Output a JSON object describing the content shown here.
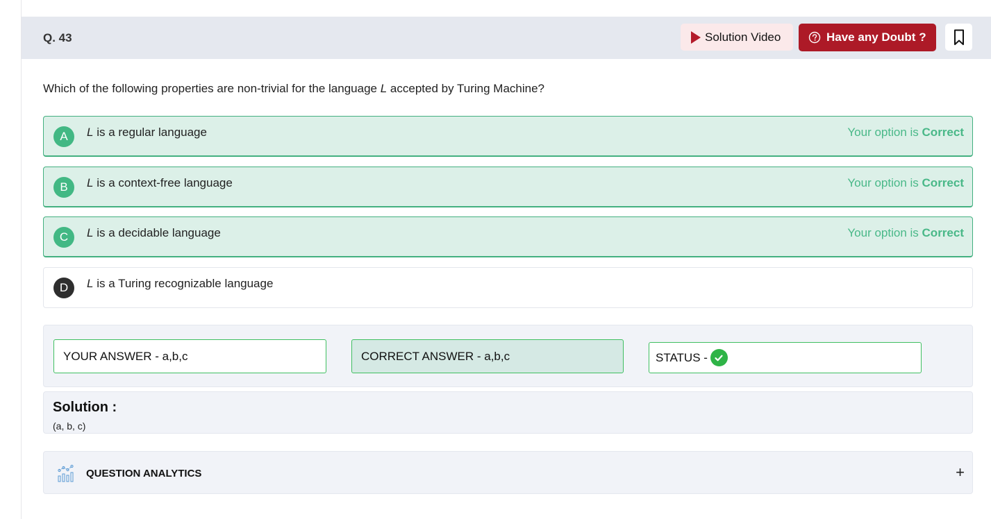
{
  "header": {
    "question_number": "Q. 43",
    "solution_video_label": "Solution Video",
    "doubt_label": "Have any Doubt ?"
  },
  "question": {
    "prefix": "Which of the following properties are non-trivial for the language ",
    "var": "L",
    "suffix": " accepted by Turing Machine?"
  },
  "options": [
    {
      "letter": "A",
      "var": "L",
      "text": " is a regular language",
      "verdict_prefix": "Your option is ",
      "verdict": "Correct"
    },
    {
      "letter": "B",
      "var": "L",
      "text": " is a context-free language",
      "verdict_prefix": "Your option is ",
      "verdict": "Correct"
    },
    {
      "letter": "C",
      "var": "L",
      "text": " is a decidable language",
      "verdict_prefix": "Your option is ",
      "verdict": "Correct"
    },
    {
      "letter": "D",
      "var": "L",
      "text": " is a Turing recognizable language"
    }
  ],
  "answer": {
    "yours": "YOUR ANSWER - a,b,c",
    "correct": "CORRECT ANSWER - a,b,c",
    "status": "STATUS -"
  },
  "solution": {
    "title": "Solution :",
    "body": "(a, b, c)"
  },
  "analytics": {
    "title": "QUESTION ANALYTICS",
    "toggle": "+"
  },
  "colors": {
    "accent_red": "#ad1a27",
    "correct_green": "#42b884",
    "status_green": "#2fb447"
  },
  "icons": [
    "play-icon",
    "doubt-icon",
    "bookmark-icon",
    "check-icon",
    "analytics-icon",
    "plus-icon"
  ]
}
